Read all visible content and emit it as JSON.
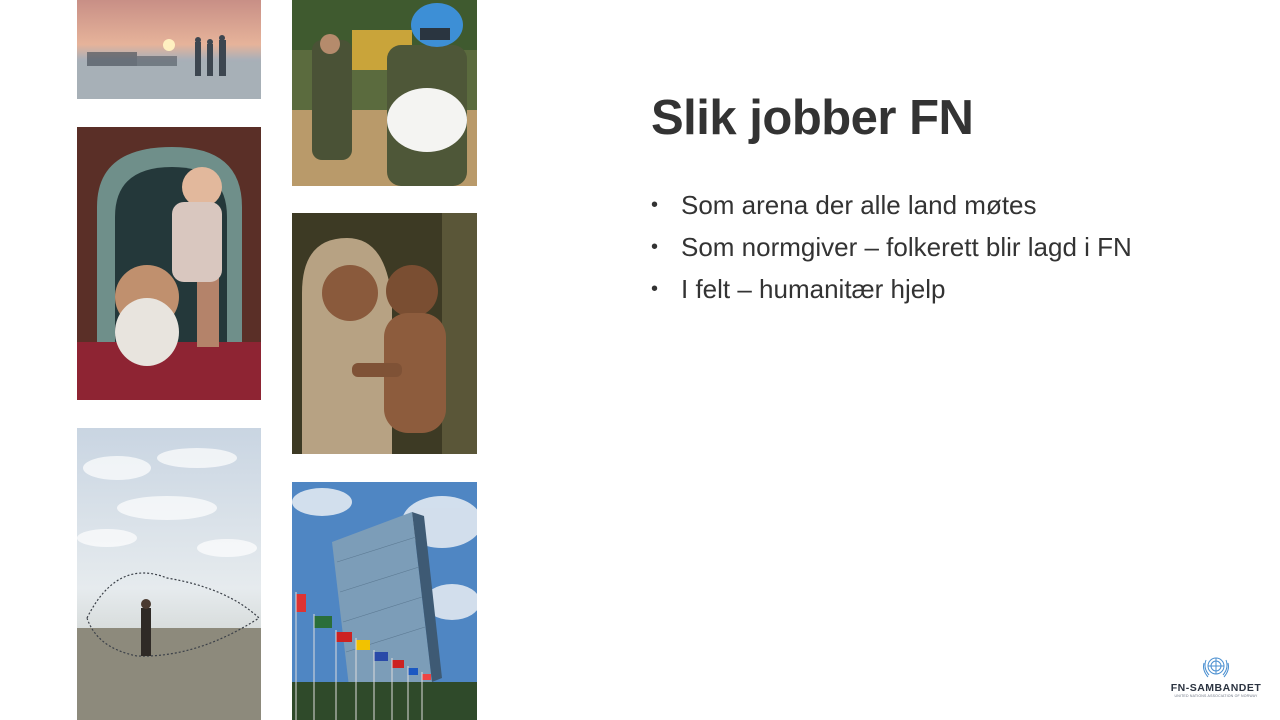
{
  "slide": {
    "title": "Slik jobber FN",
    "bullets": [
      "Som arena der alle land møtes",
      "Som normgiver – folkerett blir lagd i FN",
      "I felt – humanitær hjelp"
    ],
    "bullet_symbol": "•"
  },
  "photos": [
    {
      "name": "photo-refugees-sunset"
    },
    {
      "name": "photo-peacekeeper-with-baby"
    },
    {
      "name": "photo-old-man-lifting-baby"
    },
    {
      "name": "photo-girl-holding-child"
    },
    {
      "name": "photo-fisherman-casting-net"
    },
    {
      "name": "photo-un-headquarters-flags"
    }
  ],
  "logo": {
    "name": "FN-SAMBANDET",
    "subtitle": "UNITED NATIONS ASSOCIATION OF NORWAY",
    "icon": "un-emblem-icon",
    "color": "#4a8fd0"
  },
  "colors": {
    "text": "#333333",
    "background": "#ffffff"
  }
}
